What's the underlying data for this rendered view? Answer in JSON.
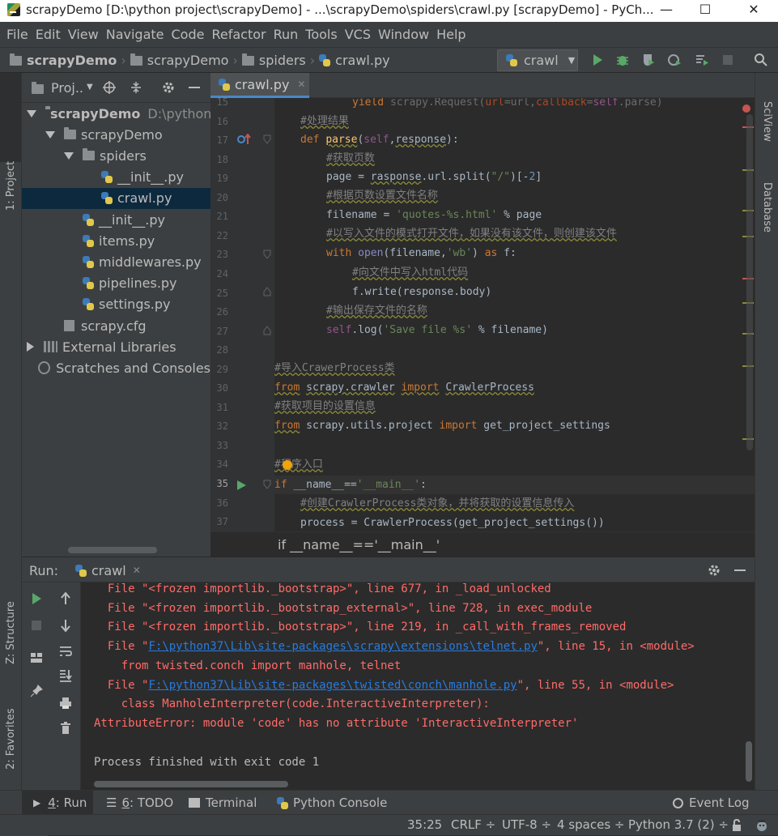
{
  "window": {
    "title": "scrapyDemo [D:\\python project\\scrapyDemo] - ...\\scrapyDemo\\spiders\\crawl.py [scrapyDemo] - PyCh...",
    "minimize": "—",
    "maximize": "☐",
    "close": "✕"
  },
  "menu": [
    "File",
    "Edit",
    "View",
    "Navigate",
    "Code",
    "Refactor",
    "Run",
    "Tools",
    "VCS",
    "Window",
    "Help"
  ],
  "breadcrumbs": [
    "scrapyDemo",
    "scrapyDemo",
    "spiders",
    "crawl.py"
  ],
  "run_config": {
    "label": "crawl"
  },
  "left_strip": {
    "project": "1: Project",
    "structure": "Z: Structure",
    "favorites": "2: Favorites"
  },
  "right_strip": {
    "sciview": "SciView",
    "database": "Database"
  },
  "project_panel": {
    "title": "Proj..",
    "tree": [
      {
        "label": "scrapyDemo",
        "suffix": "D:\\python p",
        "type": "folder",
        "level": 0,
        "expanded": true
      },
      {
        "label": "scrapyDemo",
        "type": "folder",
        "level": 1,
        "expanded": true
      },
      {
        "label": "spiders",
        "type": "folder",
        "level": 2,
        "expanded": true
      },
      {
        "label": "__init__.py",
        "type": "py",
        "level": 3
      },
      {
        "label": "crawl.py",
        "type": "py",
        "level": 3,
        "selected": true
      },
      {
        "label": "__init__.py",
        "type": "py",
        "level": 2
      },
      {
        "label": "items.py",
        "type": "py",
        "level": 2
      },
      {
        "label": "middlewares.py",
        "type": "py",
        "level": 2
      },
      {
        "label": "pipelines.py",
        "type": "py",
        "level": 2
      },
      {
        "label": "settings.py",
        "type": "py",
        "level": 2
      },
      {
        "label": "scrapy.cfg",
        "type": "cfg",
        "level": 1
      },
      {
        "label": "External Libraries",
        "type": "lib",
        "level": 0,
        "collapsed": true
      },
      {
        "label": "Scratches and Consoles",
        "type": "scratch",
        "level": 0
      }
    ]
  },
  "editor": {
    "tab": "crawl.py",
    "line_numbers": [
      "15",
      "16",
      "17",
      "18",
      "19",
      "20",
      "21",
      "22",
      "23",
      "24",
      "25",
      "26",
      "27",
      "28",
      "29",
      "30",
      "31",
      "32",
      "33",
      "34",
      "35",
      "36",
      "37"
    ],
    "breadcrumb": "if __name__=='__main__'"
  },
  "run_panel": {
    "label": "Run:",
    "tab": "crawl",
    "output": [
      "  File \"<frozen importlib._bootstrap>\", line 677, in _load_unlocked",
      "  File \"<frozen importlib._bootstrap_external>\", line 728, in exec_module",
      "  File \"<frozen importlib._bootstrap>\", line 219, in _call_with_frames_removed",
      "F:\\python37\\Lib\\site-packages\\scrapy\\extensions\\telnet.py",
      "    from twisted.conch import manhole, telnet",
      "F:\\python37\\Lib\\site-packages\\twisted\\conch\\manhole.py",
      "    class ManholeInterpreter(code.InteractiveInterpreter):",
      "AttributeError: module 'code' has no attribute 'InteractiveInterpreter'",
      "Process finished with exit code 1"
    ],
    "file_prefix": "  File \"",
    "line15": "\", line 15, in <module>",
    "line55": "\", line 55, in <module>"
  },
  "bottom_tabs": [
    {
      "num": "4",
      "label": ": Run"
    },
    {
      "num": "6",
      "label": ": TODO"
    },
    {
      "label": "Terminal"
    },
    {
      "label": "Python Console"
    },
    {
      "label": "Event Log"
    }
  ],
  "status": {
    "position": "35:25",
    "line_sep": "CRLF ÷",
    "encoding": "UTF-8 ÷",
    "indent": "4 spaces ÷",
    "interpreter": "Python 3.7 (2) ÷"
  }
}
